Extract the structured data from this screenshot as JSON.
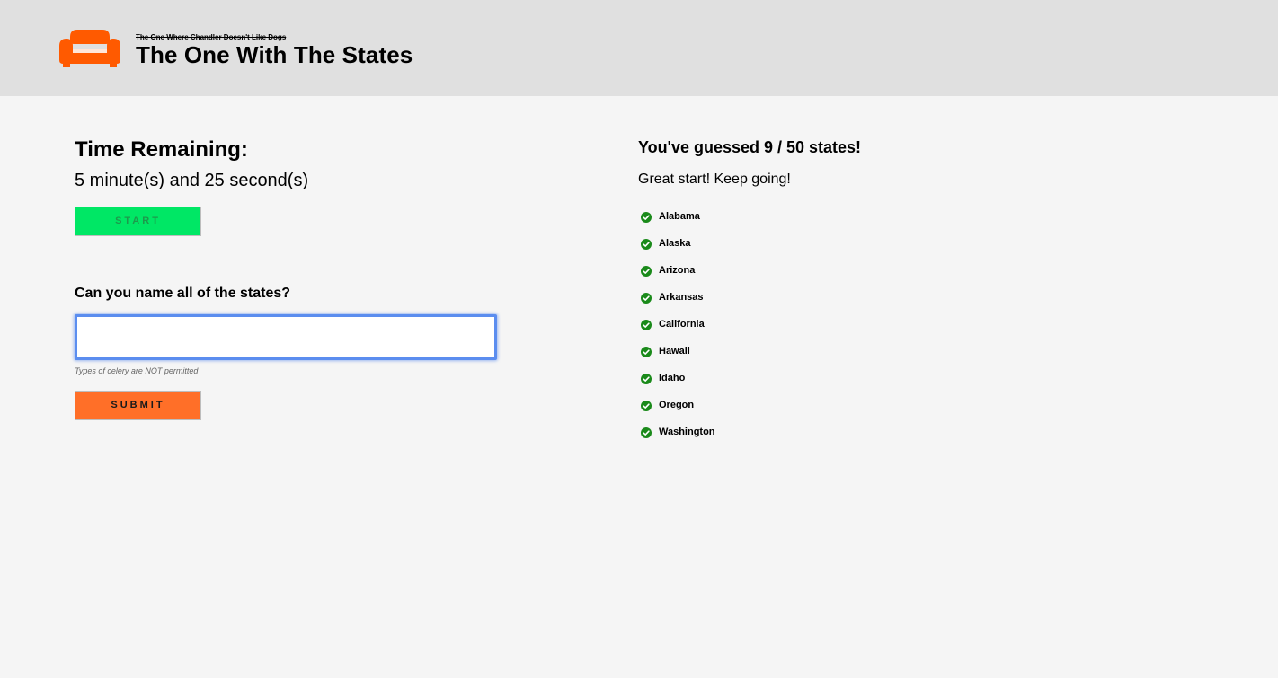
{
  "header": {
    "logo_icon": "couch-icon",
    "logo_color": "#ff5a00",
    "subtitle": "The One Where Chandler Doesn't Like Dogs",
    "title": "The One With The States"
  },
  "timer": {
    "heading": "Time Remaining:",
    "value": "5 minute(s) and 25 second(s)",
    "start_label": "START",
    "start_color": "#00e765"
  },
  "quiz": {
    "question": "Can you name all of the states?",
    "input_value": "",
    "hint": "Types of celery are NOT permitted",
    "submit_label": "SUBMIT",
    "submit_color": "#ff6f28"
  },
  "progress": {
    "heading": "You've guessed 9 / 50 states!",
    "message": "Great start! Keep going!",
    "check_icon": "check-circle-icon",
    "check_color": "#1a8a1a",
    "states": [
      "Alabama",
      "Alaska",
      "Arizona",
      "Arkansas",
      "California",
      "Hawaii",
      "Idaho",
      "Oregon",
      "Washington"
    ]
  }
}
